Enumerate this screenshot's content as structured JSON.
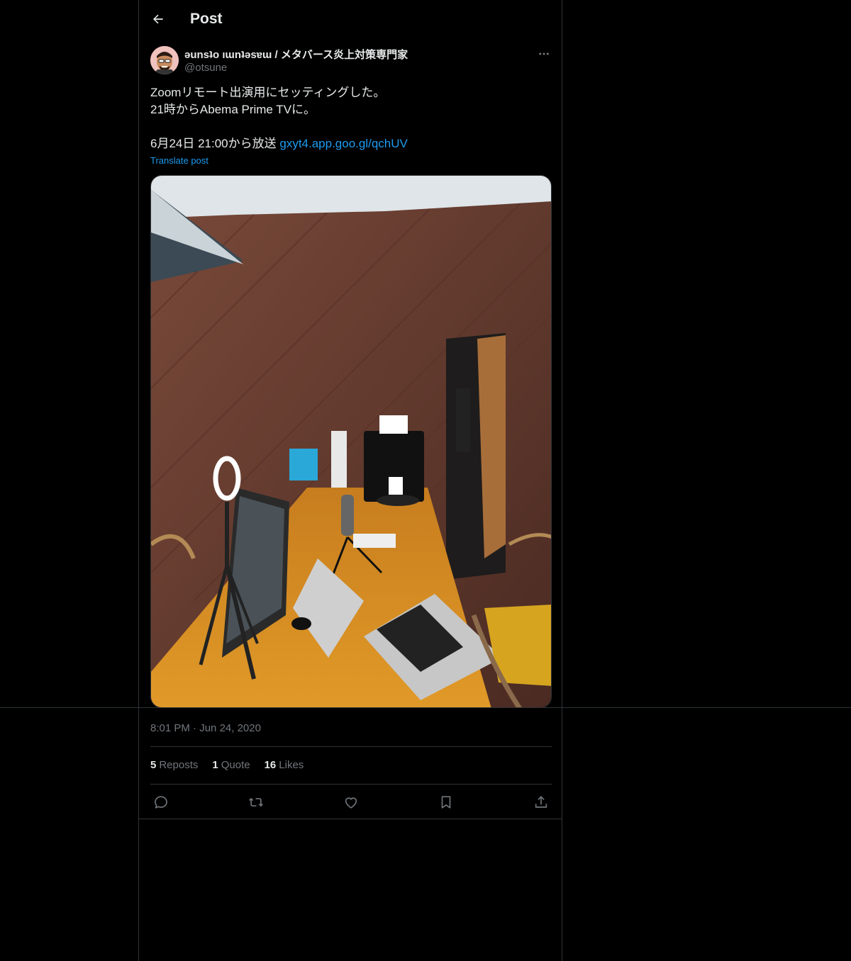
{
  "header": {
    "title": "Post",
    "back_icon": "arrow-left-icon"
  },
  "author": {
    "display_name": "ǝunsʇo ıɯnʇǝsɐɯ / メタバース炎上対策専門家",
    "handle": "@otsune",
    "more_icon": "more-horizontal-icon"
  },
  "post": {
    "lines": [
      "Zoomリモート出演用にセッティングした。",
      "21時からAbema Prime TVに。"
    ],
    "line3_text": "6月24日 21:00から放送 ",
    "link": "gxyt4.app.goo.gl/qchUV",
    "translate": "Translate post"
  },
  "meta": {
    "time": "8:01 PM",
    "separator": "·",
    "date": "Jun 24, 2020"
  },
  "stats": {
    "reposts_count": "5",
    "reposts_label": "Reposts",
    "quotes_count": "1",
    "quotes_label": "Quote",
    "likes_count": "16",
    "likes_label": "Likes"
  },
  "actions": [
    "reply-icon",
    "repost-icon",
    "like-icon",
    "bookmark-icon",
    "share-icon"
  ],
  "colors": {
    "accent": "#1d9bf0",
    "text": "#e7e9ea",
    "muted": "#71767b",
    "border": "#2f3336",
    "background": "#000000"
  }
}
